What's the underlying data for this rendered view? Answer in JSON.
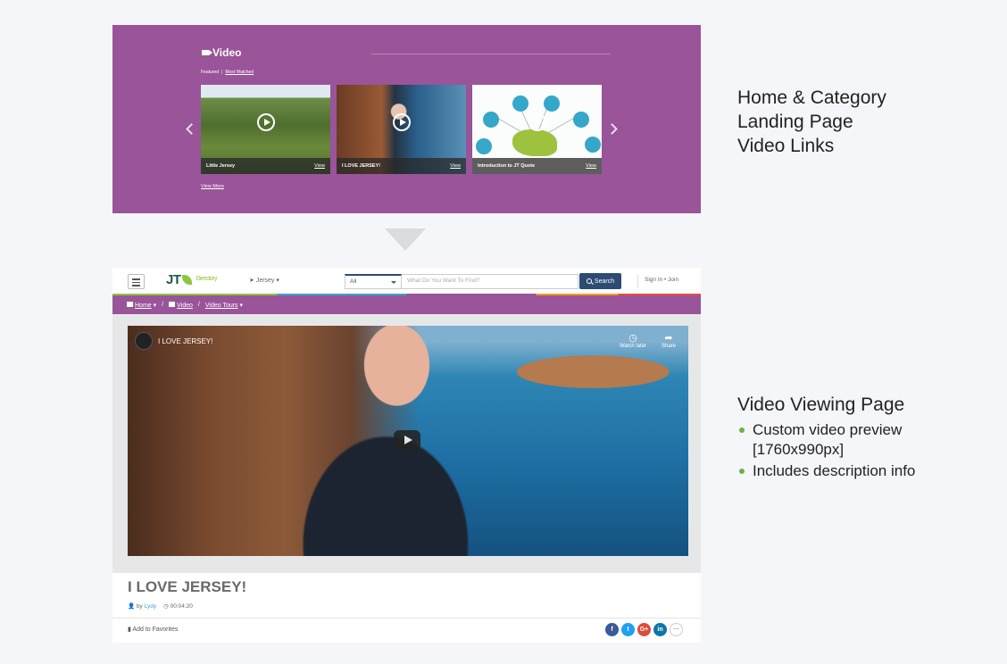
{
  "landing": {
    "title": "Video",
    "tab_featured": "Featured",
    "tab_separator": "|",
    "tab_most_watched": "Most Watched",
    "cards": [
      {
        "title": "Little Jersey",
        "view": "View"
      },
      {
        "title": "I LOVE JERSEY!",
        "view": "View"
      },
      {
        "title": "Introduction to JT Quote",
        "view": "View"
      }
    ],
    "view_more": "View More"
  },
  "captions": {
    "landing_line1": "Home & Category",
    "landing_line2": "Landing Page",
    "landing_line3": "Video Links",
    "viewing_title": "Video Viewing Page",
    "bullet1_line1": "Custom video preview",
    "bullet1_line2": "[1760x990px]",
    "bullet2": "Includes description info"
  },
  "nav": {
    "logo": "JT",
    "logo_sub": "Directory",
    "location": "Jersey",
    "category_select": "All",
    "search_placeholder": "What Do You Want To Find?",
    "search_button": "Search",
    "sign_in": "Sign In",
    "join": "Join"
  },
  "breadcrumb": {
    "home": "Home",
    "sep1": "/",
    "video": "Video",
    "sep2": "/",
    "video_tours": "Video Tours"
  },
  "player": {
    "channel_title": "I LOVE JERSEY!",
    "watch_later": "Watch later",
    "share": "Share"
  },
  "video_page": {
    "title": "I LOVE JERSEY!",
    "by": "by",
    "author": "Lydy",
    "duration": "00:04:20",
    "add_favorites": "Add to Favorites",
    "share_fb": "f",
    "share_tw": "t",
    "share_gp": "G+",
    "share_in": "in",
    "share_more": "···"
  },
  "colors": {
    "brand_purple": "#9a5499",
    "brand_green": "#8cc63f",
    "nav_blue": "#2d4b73",
    "bullet_green": "#6db33f"
  }
}
